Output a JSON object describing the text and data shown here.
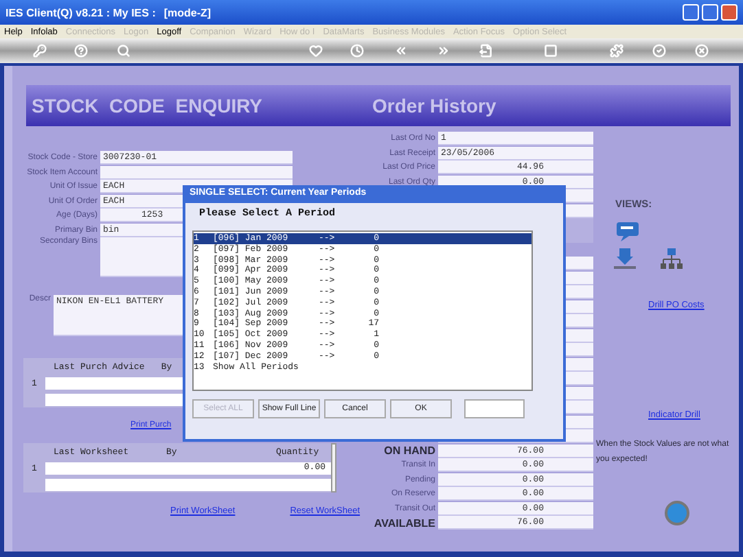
{
  "window": {
    "title": "IES Client(Q) v8.21 : My IES :",
    "mode": "[mode-Z]"
  },
  "menu": [
    {
      "label": "Help",
      "disabled": false
    },
    {
      "label": "Infolab",
      "disabled": false
    },
    {
      "label": "Connections",
      "disabled": true
    },
    {
      "label": "Logon",
      "disabled": true
    },
    {
      "label": "Logoff",
      "disabled": false
    },
    {
      "label": "Companion",
      "disabled": true
    },
    {
      "label": "Wizard",
      "disabled": true
    },
    {
      "label": "How do I",
      "disabled": true
    },
    {
      "label": "DataMarts",
      "disabled": true
    },
    {
      "label": "Business Modules",
      "disabled": true
    },
    {
      "label": "Action Focus",
      "disabled": true
    },
    {
      "label": "Option Select",
      "disabled": true
    }
  ],
  "header": {
    "title": "STOCK  CODE  ENQUIRY",
    "subtitle": "Order History"
  },
  "stock_fields": [
    {
      "label": "Stock Code - Store",
      "value": "3007230-01",
      "kind": "line"
    },
    {
      "label": "Stock Item Account",
      "kind": "line"
    },
    {
      "label": "Unit Of Issue",
      "value": "EACH",
      "kind": "line"
    },
    {
      "label": "Unit Of Order",
      "value": "EACH",
      "kind": "line"
    },
    {
      "label": "Age (Days)",
      "value": "1253",
      "kind": "number"
    },
    {
      "label": "Primary Bin",
      "value": "bin",
      "kind": "line"
    },
    {
      "label": "Secondary Bins",
      "kind": "area"
    }
  ],
  "description": {
    "label": "Descr",
    "value": "NIKON EN-EL1 BATTERY"
  },
  "order_fields": [
    {
      "label": "Last Ord No",
      "value": "1",
      "kind": "text"
    },
    {
      "label": "Last Receipt",
      "value": "23/05/2006",
      "kind": "text"
    },
    {
      "label": "Last Ord Price",
      "value": "44.96",
      "kind": "amount"
    },
    {
      "label": "Last Ord Qty",
      "value": "0.00",
      "kind": "amount"
    }
  ],
  "stock_values": [
    {
      "label": "ON HAND",
      "value": "76.00",
      "emphasis": true
    },
    {
      "label": "Transit In",
      "value": "0.00",
      "emphasis": false
    },
    {
      "label": "Pending",
      "value": "0.00",
      "emphasis": false
    },
    {
      "label": "On Reserve",
      "value": "0.00",
      "emphasis": false
    },
    {
      "label": "Transit Out",
      "value": "0.00",
      "emphasis": false
    },
    {
      "label": "AVAILABLE",
      "value": "76.00",
      "emphasis": true
    }
  ],
  "purch_advice": {
    "columns": [
      "Last Purch Advice",
      "By"
    ],
    "rows": [
      {
        "number": "1"
      }
    ],
    "link": "Print Purch"
  },
  "worksheet": {
    "columns": [
      "Last Worksheet",
      "By",
      "Quantity"
    ],
    "rows": [
      {
        "number": "1",
        "quantity": "0.00"
      }
    ],
    "links": [
      "Print WorkSheet",
      "Reset WorkSheet"
    ]
  },
  "views": {
    "label": "VIEWS:",
    "links": [
      "Drill PO Costs",
      "Indicator Drill"
    ],
    "note": "When the Stock Values are not what you expected!"
  },
  "dialog": {
    "title": "SINGLE SELECT: Current Year Periods",
    "prompt": "Please Select A Period",
    "items": [
      {
        "number": "1",
        "period": "[096] Jan 2009",
        "arrow": "-->",
        "count": "0",
        "selected": true
      },
      {
        "number": "2",
        "period": "[097] Feb 2009",
        "arrow": "-->",
        "count": "0",
        "selected": false
      },
      {
        "number": "3",
        "period": "[098] Mar 2009",
        "arrow": "-->",
        "count": "0",
        "selected": false
      },
      {
        "number": "4",
        "period": "[099] Apr 2009",
        "arrow": "-->",
        "count": "0",
        "selected": false
      },
      {
        "number": "5",
        "period": "[100] May 2009",
        "arrow": "-->",
        "count": "0",
        "selected": false
      },
      {
        "number": "6",
        "period": "[101] Jun 2009",
        "arrow": "-->",
        "count": "0",
        "selected": false
      },
      {
        "number": "7",
        "period": "[102] Jul 2009",
        "arrow": "-->",
        "count": "0",
        "selected": false
      },
      {
        "number": "8",
        "period": "[103] Aug 2009",
        "arrow": "-->",
        "count": "0",
        "selected": false
      },
      {
        "number": "9",
        "period": "[104] Sep 2009",
        "arrow": "-->",
        "count": "17",
        "selected": false
      },
      {
        "number": "10",
        "period": "[105] Oct 2009",
        "arrow": "-->",
        "count": "1",
        "selected": false
      },
      {
        "number": "11",
        "period": "[106] Nov 2009",
        "arrow": "-->",
        "count": "0",
        "selected": false
      },
      {
        "number": "12",
        "period": "[107] Dec 2009",
        "arrow": "-->",
        "count": "0",
        "selected": false
      },
      {
        "number": "13",
        "period": "Show All Periods",
        "selected": false
      }
    ],
    "buttons": [
      {
        "label": "Select ALL",
        "disabled": true
      },
      {
        "label": "Show Full Line",
        "disabled": false
      },
      {
        "label": "Cancel",
        "disabled": false
      },
      {
        "label": "OK",
        "disabled": false
      }
    ]
  }
}
